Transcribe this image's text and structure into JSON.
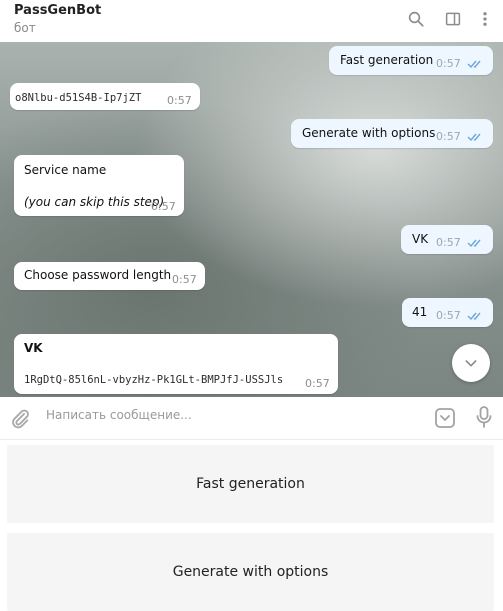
{
  "header": {
    "title": "PassGenBot",
    "subtitle": "бот"
  },
  "messages": [
    {
      "text": "Fast generation",
      "time": "0:57"
    },
    {
      "text": "o8Nlbu-d51S4B-Ip7jZT",
      "time": "0:57"
    },
    {
      "text": "Generate with options",
      "time": "0:57"
    },
    {
      "line1": "Service name",
      "line2": "(you can skip this step)",
      "time": "0:57"
    },
    {
      "text": "VK",
      "time": "0:57"
    },
    {
      "text": "Choose password length",
      "time": "0:57"
    },
    {
      "text": "41",
      "time": "0:57"
    },
    {
      "line1": "VK",
      "line2": "1RgDtQ-85l6nL-vbyzHz-Pk1GLt-BMPJfJ-USSJls",
      "time": "0:57"
    }
  ],
  "input": {
    "placeholder": "Написать сообщение..."
  },
  "keyboard": {
    "buttons": [
      "Fast generation",
      "Generate with options"
    ]
  },
  "icons": {
    "search": "search-icon",
    "sidebar": "sidebar-toggle-icon",
    "menu": "more-vertical-icon",
    "attach": "paperclip-icon",
    "keyboard": "bot-keyboard-icon",
    "mic": "microphone-icon",
    "scroll": "chevron-down-icon",
    "read": "double-check-icon"
  },
  "colors": {
    "outgoing": "#eef7ff",
    "incoming": "#ffffff",
    "read_ticks": "#6aa7d8"
  }
}
